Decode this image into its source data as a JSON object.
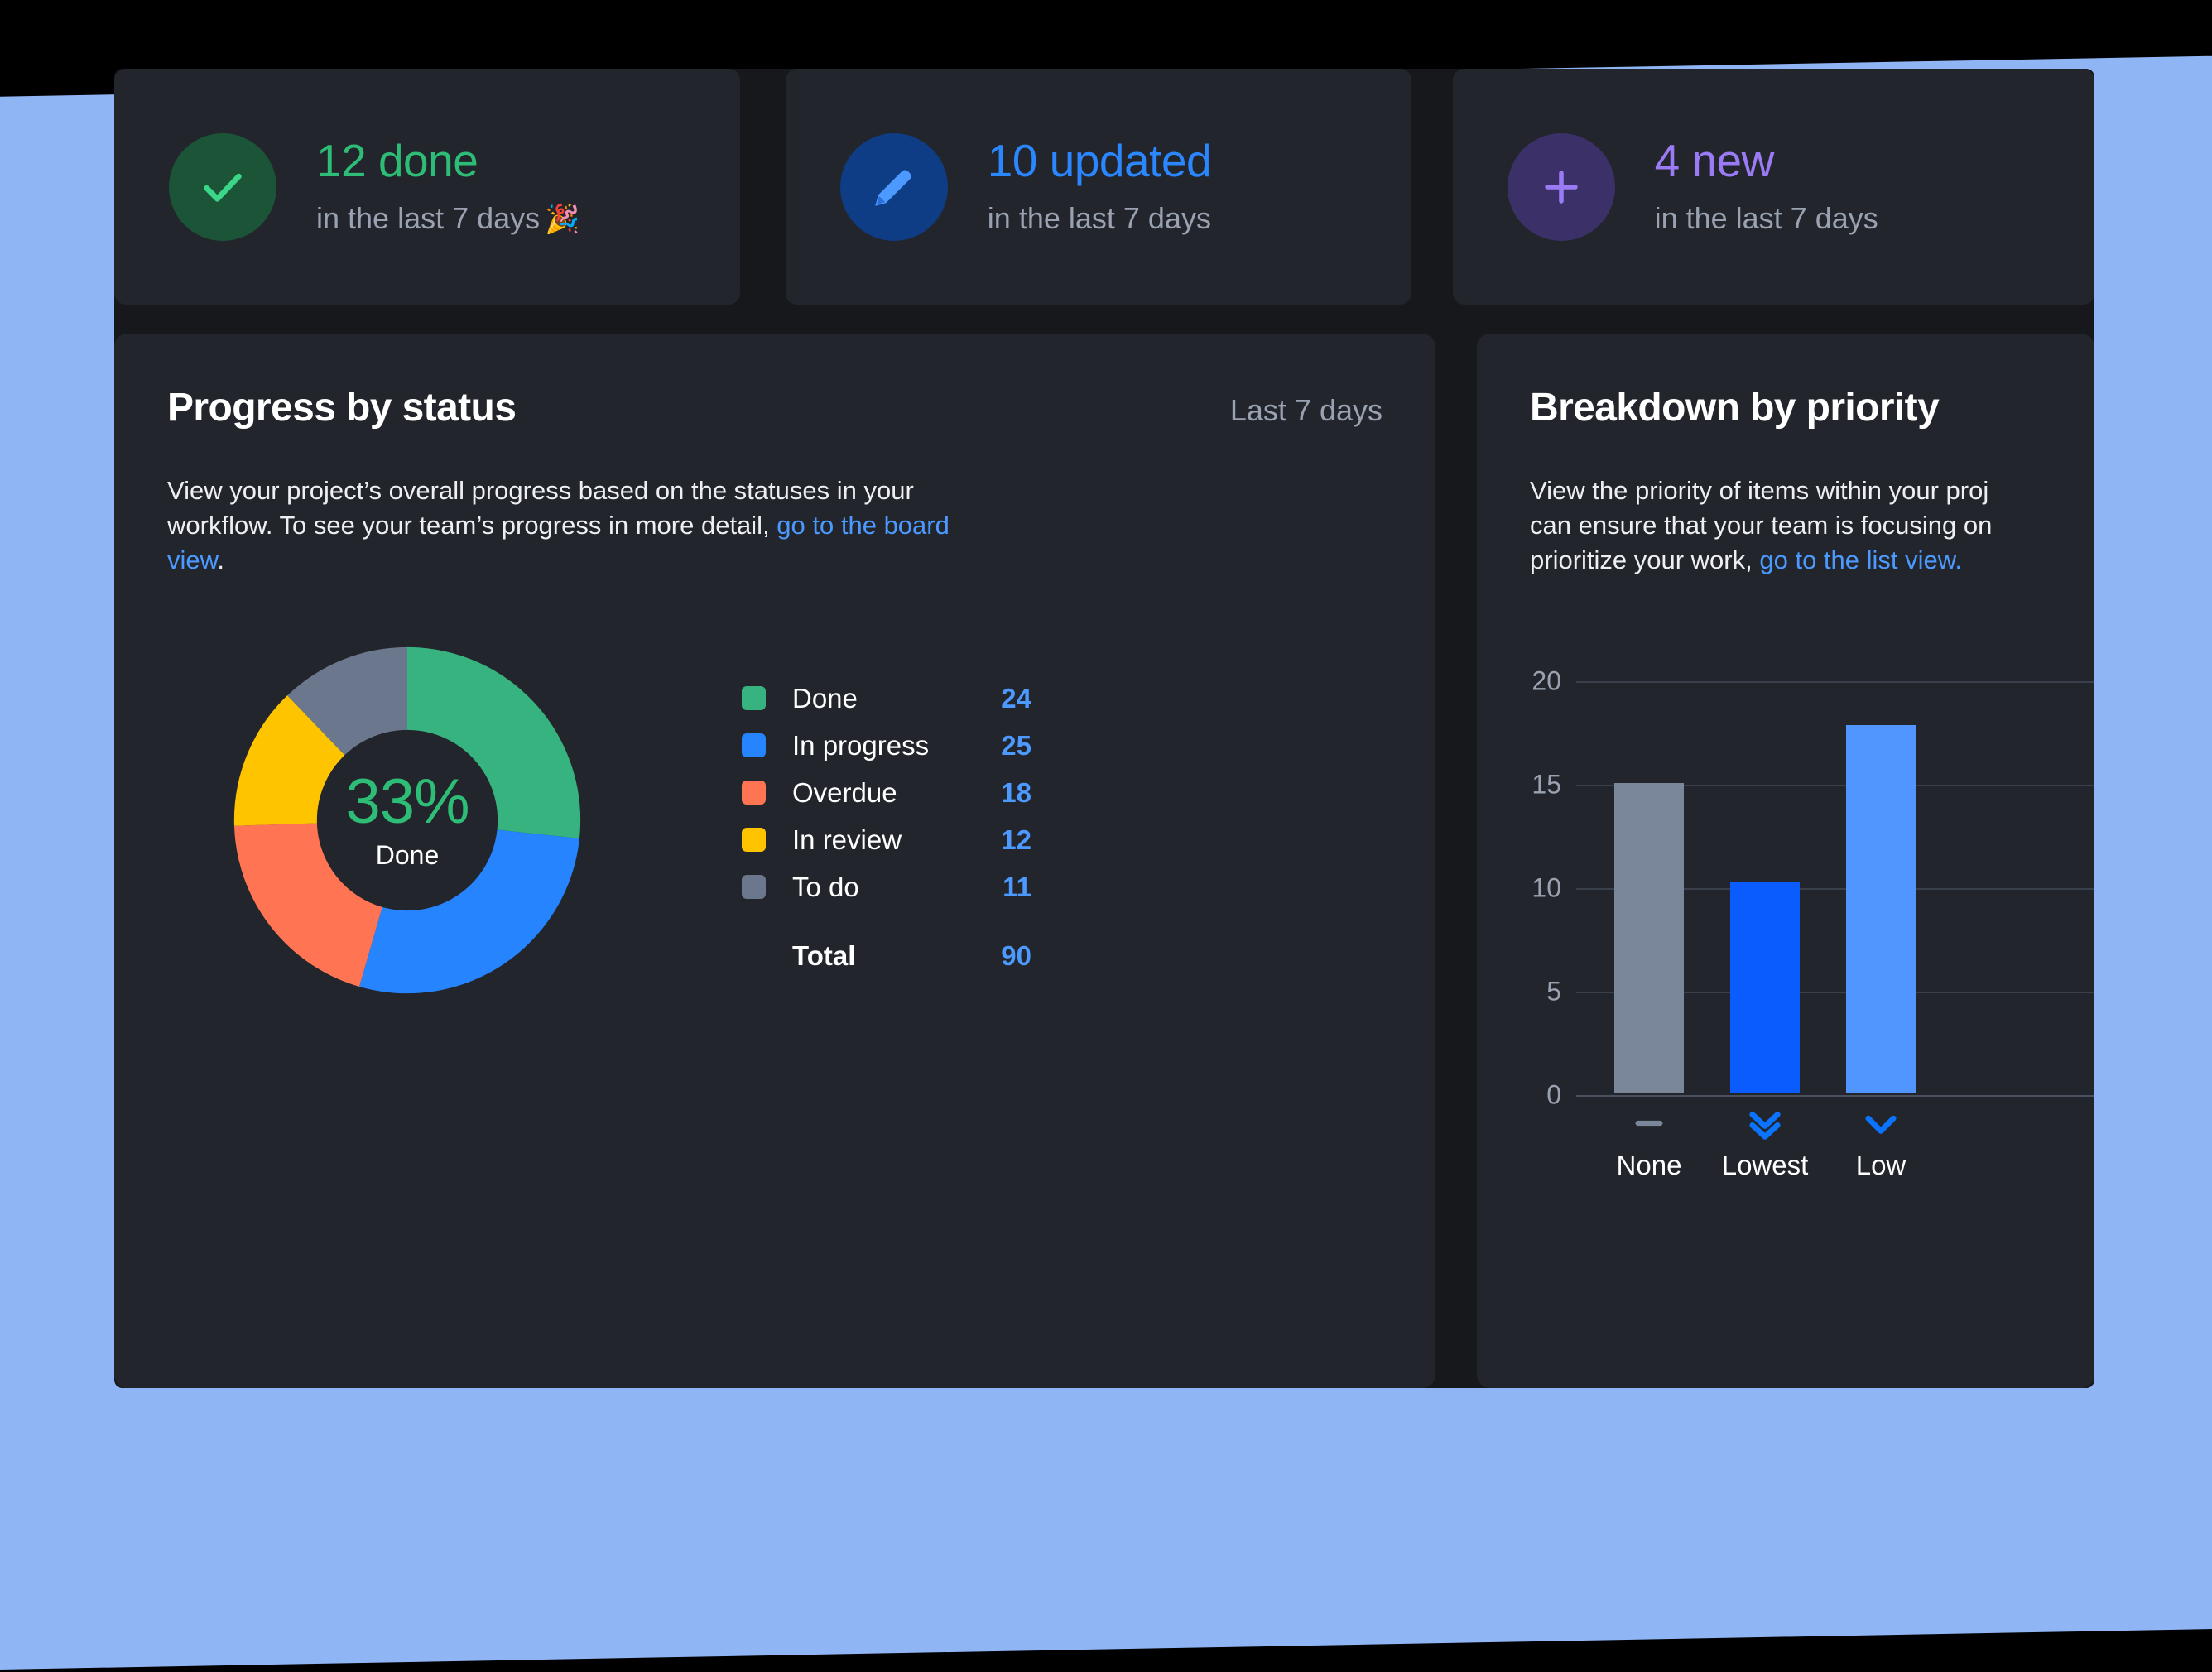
{
  "theme": {
    "page_background": "#000000",
    "accent_sheet": "#8FB5F5",
    "surface": "#16181C",
    "card": "#22252B",
    "link": "#4C9AFF",
    "muted_text": "#9AA2B1"
  },
  "stats": [
    {
      "icon": "check-icon",
      "icon_color": "#3BD687",
      "badge_color": "#1C5438",
      "value_color": "#2EBD77",
      "headline": "12 done",
      "subline": "in the last 7 days",
      "emoji": "🎉"
    },
    {
      "icon": "pencil-icon",
      "icon_color": "#4C9AFF",
      "badge_color": "#0E3C85",
      "value_color": "#2B87FF",
      "headline": "10 updated",
      "subline": "in the last 7 days",
      "emoji": ""
    },
    {
      "icon": "plus-icon",
      "icon_color": "#9A7BF5",
      "badge_color": "#3B3168",
      "value_color": "#9A7BF5",
      "headline": "4 new",
      "subline": "in the last 7 days",
      "emoji": ""
    }
  ],
  "progress_panel": {
    "title": "Progress by status",
    "range": "Last 7 days",
    "description_before": "View your project’s overall progress based on the statuses in your workflow. To see your team’s progress in more detail, ",
    "description_link": "go to the board view",
    "description_after": ".",
    "center_percent": "33%",
    "center_label": "Done",
    "total_label": "Total",
    "total_value": "90"
  },
  "priority_panel": {
    "title": "Breakdown by priority",
    "description_line1": "View the priority of items within your proj",
    "description_line2": "can ensure that your team is focusing on",
    "description_line3_before": "prioritize your work, ",
    "description_link": "go to the list view."
  },
  "chart_data": [
    {
      "type": "pie",
      "title": "Progress by status",
      "subtitle": "Last 7 days",
      "center_text": "33%",
      "center_sublabel": "Done",
      "legend_position": "right",
      "categories": [
        "Done",
        "In progress",
        "Overdue",
        "In review",
        "To do"
      ],
      "values": [
        24,
        25,
        18,
        12,
        11
      ],
      "colors": [
        "#36B37E",
        "#2684FF",
        "#FF7452",
        "#FFC400",
        "#6B778C"
      ],
      "total": 90,
      "labels": [
        "Done",
        "In progress",
        "Overdue",
        "In review",
        "To do"
      ],
      "value_labels": [
        "24",
        "25",
        "18",
        "12",
        "11"
      ],
      "start_angle_deg": 0,
      "inner_radius_ratio": 0.53
    },
    {
      "type": "bar",
      "title": "Breakdown by priority",
      "categories": [
        "None",
        "Lowest",
        "Low"
      ],
      "category_icons": [
        "dash-icon",
        "double-chevron-down-icon",
        "chevron-down-icon"
      ],
      "values": [
        15,
        10.2,
        17.8
      ],
      "colors": [
        "#7A8699",
        "#0B5CFF",
        "#5196FF"
      ],
      "xlabel": "",
      "ylabel": "",
      "ylim": [
        0,
        20
      ],
      "yticks": [
        0,
        5,
        10,
        15,
        20
      ],
      "ytick_labels": [
        "0",
        "5",
        "10",
        "15",
        "20"
      ],
      "grid": true,
      "legend_position": "none"
    }
  ]
}
